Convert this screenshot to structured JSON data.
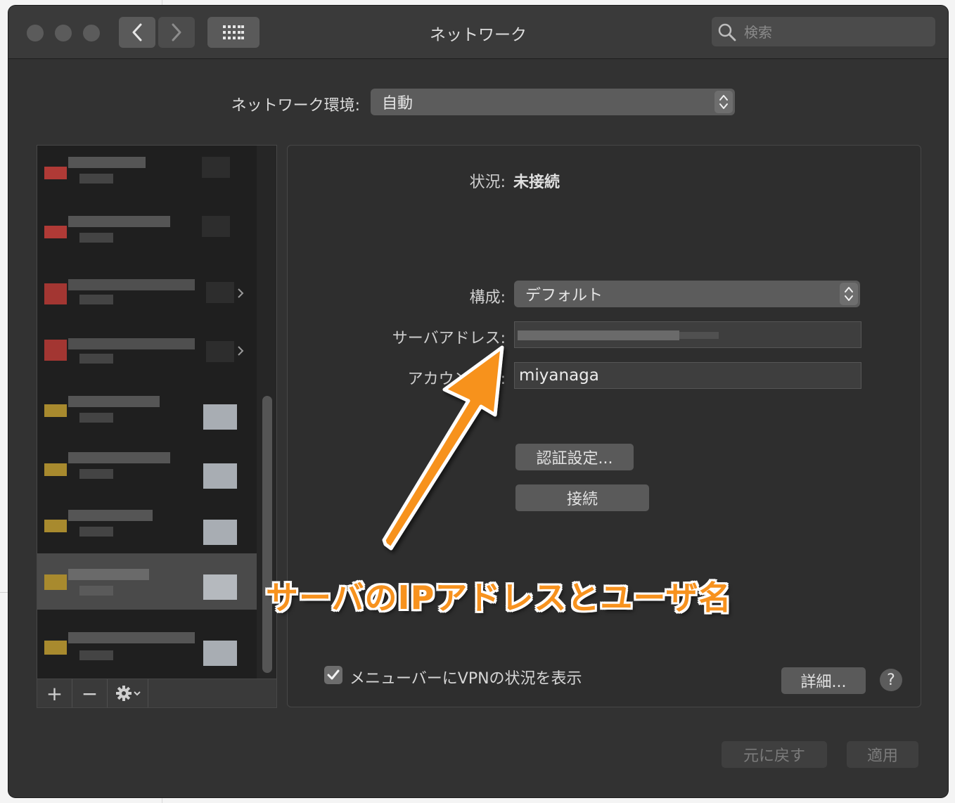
{
  "window": {
    "title": "ネットワーク",
    "search_placeholder": "検索"
  },
  "location": {
    "label": "ネットワーク環境:",
    "value": "自動"
  },
  "detail": {
    "status_label": "状況:",
    "status_value": "未接続",
    "config_label": "構成:",
    "config_value": "デフォルト",
    "server_label": "サーバアドレス:",
    "server_value": "",
    "account_label": "アカウント名:",
    "account_value": "miyanaga",
    "auth_button": "認証設定...",
    "connect_button": "接続",
    "show_vpn_label": "メニューバーにVPNの状況を表示",
    "show_vpn_checked": true,
    "advanced_button": "詳細...",
    "help_button": "?"
  },
  "sidebar": {
    "add_button": "+",
    "remove_button": "−",
    "services_obscured": true
  },
  "footer": {
    "revert_button": "元に戻す",
    "apply_button": "適用"
  },
  "annotation": {
    "text": "サーバのIPアドレスとユーザ名",
    "color": "#f7921e"
  }
}
